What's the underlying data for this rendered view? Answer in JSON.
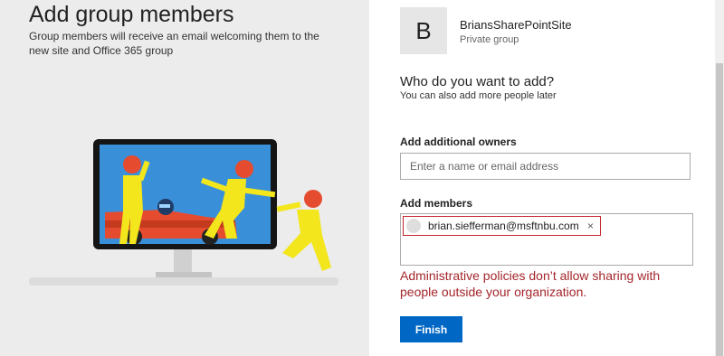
{
  "left": {
    "title": "Add group members",
    "subtitle": "Group members will receive an email welcoming them to the new site and Office 365 group"
  },
  "site": {
    "avatar_letter": "B",
    "name": "BriansSharePointSite",
    "privacy": "Private group"
  },
  "form": {
    "question": "Who do you want to add?",
    "hint": "You can also add more people later",
    "owners_label": "Add additional owners",
    "owners_placeholder": "Enter a name or email address",
    "members_label": "Add members",
    "members": [
      {
        "email": "brian.siefferman@msftnbu.com",
        "remove_glyph": "×",
        "error": true
      }
    ],
    "error_message": "Administrative policies don’t allow sharing with people outside your organization.",
    "finish_label": "Finish"
  },
  "colors": {
    "error": "#a4262c",
    "primary_button": "#0067c5",
    "left_panel_bg": "#ececec"
  }
}
